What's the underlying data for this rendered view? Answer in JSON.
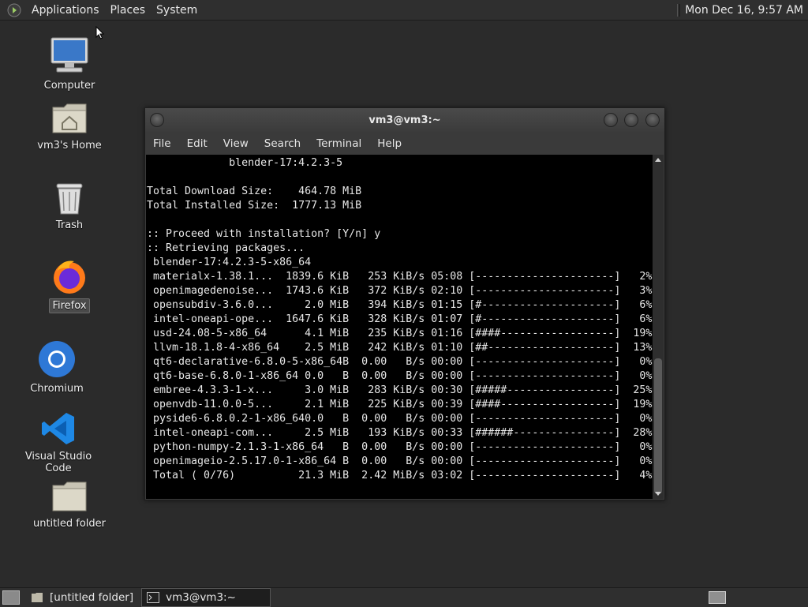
{
  "top_panel": {
    "menus": [
      "Applications",
      "Places",
      "System"
    ],
    "clock": "Mon Dec 16,  9:57 AM"
  },
  "desktop_icons": [
    {
      "label": "Computer",
      "icon": "computer-icon"
    },
    {
      "label": "vm3's Home",
      "icon": "home-folder-icon"
    },
    {
      "label": "Trash",
      "icon": "trash-icon"
    },
    {
      "label": "Firefox",
      "icon": "firefox-icon"
    },
    {
      "label": "Chromium",
      "icon": "chromium-icon"
    },
    {
      "label": "Visual Studio Code",
      "icon": "vscode-icon"
    },
    {
      "label": "untitled folder",
      "icon": "folder-icon"
    }
  ],
  "terminal": {
    "title": "vm3@vm3:~",
    "menu": [
      "File",
      "Edit",
      "View",
      "Search",
      "Terminal",
      "Help"
    ],
    "lines": [
      "             blender-17:4.2.3-5",
      "",
      "Total Download Size:    464.78 MiB",
      "Total Installed Size:  1777.13 MiB",
      "",
      ":: Proceed with installation? [Y/n] y",
      ":: Retrieving packages...",
      " blender-17:4.2.3-5-x86_64",
      " materialx-1.38.1...  1839.6 KiB   253 KiB/s 05:08 [----------------------]   2%",
      " openimagedenoise...  1743.6 KiB   372 KiB/s 02:10 [----------------------]   3%",
      " opensubdiv-3.6.0...     2.0 MiB   394 KiB/s 01:15 [#---------------------]   6%",
      " intel-oneapi-ope...  1647.6 KiB   328 KiB/s 01:07 [#---------------------]   6%",
      " usd-24.08-5-x86_64      4.1 MiB   235 KiB/s 01:16 [####------------------]  19%",
      " llvm-18.1.8-4-x86_64    2.5 MiB   242 KiB/s 01:10 [##--------------------]  13%",
      " qt6-declarative-6.8.0-5-x86_64B  0.00   B/s 00:00 [----------------------]   0%",
      " qt6-base-6.8.0-1-x86_64 0.0   B  0.00   B/s 00:00 [----------------------]   0%",
      " embree-4.3.3-1-x...     3.0 MiB   283 KiB/s 00:30 [#####-----------------]  25%",
      " openvdb-11.0.0-5...     2.1 MiB   225 KiB/s 00:39 [####------------------]  19%",
      " pyside6-6.8.0.2-1-x86_640.0   B  0.00   B/s 00:00 [----------------------]   0%",
      " intel-oneapi-com...     2.5 MiB   193 KiB/s 00:33 [######----------------]  28%",
      " python-numpy-2.1.3-1-x86_64   B  0.00   B/s 00:00 [----------------------]   0%",
      " openimageio-2.5.17.0-1-x86_64 B  0.00   B/s 00:00 [----------------------]   0%",
      " Total ( 0/76)          21.3 MiB  2.42 MiB/s 03:02 [----------------------]   4%"
    ]
  },
  "taskbar": {
    "tasks": [
      {
        "label": "[untitled folder]",
        "icon": "folder-icon",
        "active": false
      },
      {
        "label": "vm3@vm3:~",
        "icon": "terminal-icon",
        "active": true
      }
    ]
  }
}
